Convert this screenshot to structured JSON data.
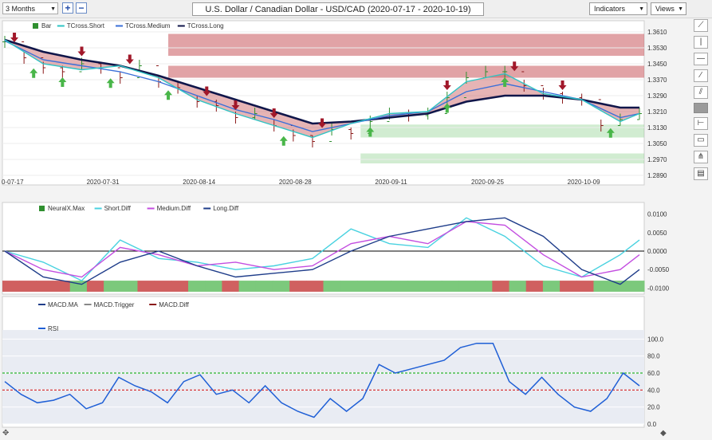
{
  "toolbar": {
    "period": "3 Months",
    "zoom_in": "+",
    "zoom_out": "−",
    "title": "U.S. Dollar / Canadian Dollar - USD/CAD (2020-07-17 - 2020-10-19)",
    "indicators": "Indicators",
    "views": "Views"
  },
  "colors": {
    "bar_up": "#2f8f2f",
    "bar_down": "#8b1a1a",
    "tcross_short": "#2ec4c4",
    "tcross_medium": "#3a6fd8",
    "tcross_long": "#10164a",
    "short_diff": "#49d2e0",
    "medium_diff": "#c34ee0",
    "long_diff": "#1f3d8a",
    "rsi": "#1f5fd6",
    "rsi_upper": "#2fb52f",
    "rsi_lower": "#d42222",
    "band_red": "#c8585c",
    "band_green": "#7cc97c"
  },
  "chart_data": [
    {
      "panel": "price",
      "type": "line",
      "legend": [
        "Bar",
        "TCross.Short",
        "TCross.Medium",
        "TCross.Long"
      ],
      "x_ticks": [
        "0-07-17",
        "2020-07-31",
        "2020-08-14",
        "2020-08-28",
        "2020-09-11",
        "2020-09-25",
        "2020-10-09"
      ],
      "y_ticks": [
        "1.3610",
        "1.3530",
        "1.3450",
        "1.3370",
        "1.3290",
        "1.3210",
        "1.3130",
        "1.3050",
        "1.2970",
        "1.2890"
      ],
      "ylim": [
        1.289,
        1.364
      ],
      "resistance_zones": [
        [
          1.349,
          1.36
        ],
        [
          1.338,
          1.344
        ]
      ],
      "support_zones": [
        [
          1.295,
          1.3
        ],
        [
          1.308,
          1.3145
        ]
      ],
      "short_x": [
        0,
        4,
        8,
        12,
        16,
        20,
        24,
        28,
        32,
        36,
        40,
        44,
        48,
        52,
        56,
        60,
        64,
        66
      ],
      "short_y": [
        1.357,
        1.345,
        1.342,
        1.344,
        1.338,
        1.327,
        1.32,
        1.314,
        1.308,
        1.315,
        1.32,
        1.321,
        1.336,
        1.34,
        1.33,
        1.327,
        1.316,
        1.32
      ],
      "medium_x": [
        0,
        4,
        8,
        12,
        16,
        20,
        24,
        28,
        32,
        36,
        40,
        44,
        48,
        52,
        56,
        60,
        64,
        66
      ],
      "medium_y": [
        1.3565,
        1.347,
        1.344,
        1.341,
        1.336,
        1.329,
        1.322,
        1.317,
        1.311,
        1.315,
        1.319,
        1.321,
        1.331,
        1.335,
        1.331,
        1.327,
        1.318,
        1.32
      ],
      "long_x": [
        0,
        4,
        8,
        12,
        16,
        20,
        24,
        28,
        32,
        36,
        40,
        44,
        48,
        52,
        56,
        60,
        64,
        66
      ],
      "long_y": [
        1.357,
        1.351,
        1.347,
        1.344,
        1.339,
        1.333,
        1.327,
        1.321,
        1.315,
        1.316,
        1.318,
        1.32,
        1.326,
        1.329,
        1.329,
        1.327,
        1.323,
        1.323
      ],
      "bar_x": [
        0,
        2,
        4,
        6,
        8,
        10,
        12,
        14,
        16,
        18,
        20,
        22,
        24,
        26,
        28,
        30,
        32,
        34,
        36,
        38,
        40,
        42,
        44,
        46,
        48,
        50,
        52,
        54,
        56,
        58,
        60,
        62,
        64,
        66
      ],
      "bar_close": [
        1.356,
        1.348,
        1.343,
        1.341,
        1.345,
        1.343,
        1.338,
        1.344,
        1.336,
        1.333,
        1.326,
        1.324,
        1.318,
        1.32,
        1.314,
        1.309,
        1.306,
        1.312,
        1.31,
        1.316,
        1.32,
        1.319,
        1.32,
        1.328,
        1.338,
        1.341,
        1.341,
        1.334,
        1.33,
        1.328,
        1.327,
        1.314,
        1.317,
        1.32
      ],
      "buy_signals_x": [
        3,
        6,
        11,
        17,
        29,
        38,
        46,
        52,
        63
      ],
      "sell_signals_x": [
        1,
        8,
        13,
        21,
        24,
        28,
        33,
        46,
        53,
        58
      ]
    },
    {
      "panel": "neuralx",
      "type": "line",
      "legend": [
        "NeuralX.Max",
        "Short.Diff",
        "Medium.Diff",
        "Long.Diff"
      ],
      "y_ticks": [
        "0.0100",
        "0.0050",
        "0.0000",
        "-0.0050",
        "-0.0100"
      ],
      "ylim": [
        -0.011,
        0.011
      ],
      "x": [
        0,
        4,
        8,
        12,
        16,
        20,
        24,
        28,
        32,
        36,
        40,
        44,
        48,
        52,
        56,
        60,
        64,
        66
      ],
      "short_diff": [
        0.0,
        -0.003,
        -0.008,
        0.003,
        -0.002,
        -0.003,
        -0.005,
        -0.004,
        -0.002,
        0.006,
        0.002,
        0.001,
        0.009,
        0.004,
        -0.004,
        -0.007,
        -0.001,
        0.003
      ],
      "medium_diff": [
        0.0,
        -0.005,
        -0.007,
        0.001,
        -0.001,
        -0.004,
        -0.003,
        -0.005,
        -0.004,
        0.002,
        0.004,
        0.002,
        0.008,
        0.007,
        -0.001,
        -0.007,
        -0.005,
        -0.001
      ],
      "long_diff": [
        0.0,
        -0.007,
        -0.009,
        -0.003,
        0.0,
        -0.004,
        -0.007,
        -0.006,
        -0.005,
        0.0,
        0.004,
        0.006,
        0.008,
        0.009,
        0.004,
        -0.005,
        -0.009,
        -0.005
      ],
      "neuralx_bars": [
        -1,
        -1,
        -1,
        -1,
        1,
        -1,
        1,
        1,
        -1,
        -1,
        -1,
        1,
        1,
        -1,
        1,
        1,
        1,
        -1,
        -1,
        1,
        1,
        1,
        1,
        1,
        1,
        1,
        1,
        1,
        1,
        -1,
        1,
        -1,
        1,
        -1,
        -1,
        1,
        1,
        1
      ]
    },
    {
      "panel": "macd",
      "type": "line",
      "legend": [
        "MACD.MA",
        "MACD.Trigger",
        "MACD.Diff"
      ]
    },
    {
      "panel": "rsi",
      "type": "line",
      "legend": [
        "RSI"
      ],
      "y_ticks": [
        "100.0",
        "80.0",
        "60.0",
        "40.0",
        "20.0",
        "0.0"
      ],
      "ylim": [
        0,
        105
      ],
      "upper_level": 60,
      "lower_level": 40,
      "x": [
        0,
        2,
        4,
        6,
        8,
        10,
        12,
        14,
        16,
        18,
        20,
        22,
        24,
        26,
        28,
        30,
        32,
        34,
        36,
        38,
        40,
        42,
        44,
        46,
        48,
        50,
        52,
        54,
        56,
        58,
        60,
        62,
        64,
        66
      ],
      "values": [
        50,
        35,
        25,
        28,
        35,
        18,
        25,
        55,
        45,
        38,
        25,
        50,
        58,
        35,
        40,
        25,
        45,
        25,
        15,
        8,
        30,
        15,
        30,
        70,
        60,
        65,
        70,
        75,
        90,
        95,
        95,
        50,
        35,
        55,
        35,
        20,
        15,
        30,
        60,
        45
      ]
    }
  ]
}
